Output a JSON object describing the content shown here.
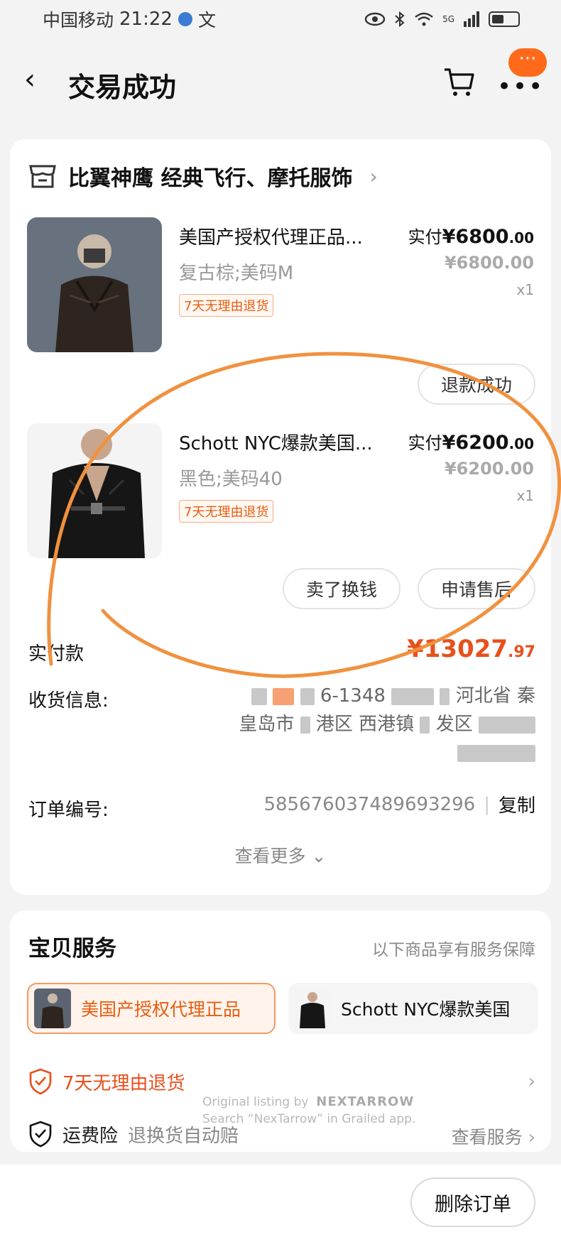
{
  "status_bar": {
    "carrier": "中国移动",
    "time": "21:22",
    "lang_glyph": "文",
    "signal": "5G"
  },
  "nav": {
    "title": "交易成功",
    "more": "•••",
    "badge": "···"
  },
  "shop": {
    "name": "比翼神鹰 经典飞行、摩托服饰",
    "arrow": "›"
  },
  "products": [
    {
      "title": "美国产授权代理正品...",
      "sku": "复古棕;美码M",
      "tag": "7天无理由退货",
      "paid_label": "实付",
      "paid_amount": "¥6800",
      "paid_cents": ".00",
      "orig_price": "¥6800.00",
      "qty": "x1",
      "action": "退款成功"
    },
    {
      "title": "Schott NYC爆款美国...",
      "sku": "黑色;美码40",
      "tag": "7天无理由退货",
      "paid_label": "实付",
      "paid_amount": "¥6200",
      "paid_cents": ".00",
      "orig_price": "¥6200.00",
      "qty": "x1",
      "actions": [
        "卖了换钱",
        "申请售后"
      ]
    }
  ],
  "order": {
    "total_label": "实付款",
    "total_amount": "¥13027",
    "total_cents": ".97",
    "shipping_label": "收货信息:",
    "address_line1_a": "6-1348",
    "address_line1_b": "河北省 秦",
    "address_line2_a": "皇岛市",
    "address_line2_b": "港区 西港镇",
    "address_line2_c": "发区",
    "order_no_label": "订单编号:",
    "order_no": "585676037489693296",
    "divider": "|",
    "copy": "复制",
    "more": "查看更多 ⌄"
  },
  "service": {
    "title": "宝贝服务",
    "subtitle": "以下商品享有服务保障",
    "tabs": [
      "美国产授权代理正品",
      "Schott NYC爆款美国"
    ],
    "row1": "7天无理由退货",
    "row2_label": "运费险",
    "row2_desc": "退换货自动赔",
    "row2_link": "查看服务",
    "chevron": "›"
  },
  "watermark": {
    "line1": "Original listing by",
    "brand": "NEXTARROW",
    "line2": "Search “NexTarrow” in Grailed app."
  },
  "bottom": {
    "delete": "删除订单"
  },
  "colors": {
    "accent": "#e8501b",
    "annotation": "#f0913f",
    "badge": "#ff6a1a"
  }
}
